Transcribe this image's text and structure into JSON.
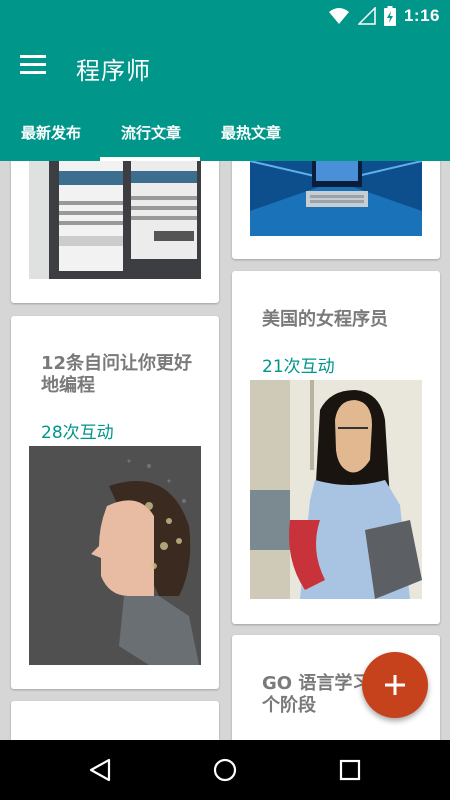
{
  "status_bar": {
    "time": "1:16",
    "icons": [
      "wifi-icon",
      "signal-icon",
      "battery-icon"
    ]
  },
  "app_bar": {
    "menu_icon": "hamburger-menu-icon",
    "title": "程序师"
  },
  "tabs": [
    {
      "label": "最新发布",
      "selected": false
    },
    {
      "label": "流行文章",
      "selected": true
    },
    {
      "label": "最热文章",
      "selected": false
    }
  ],
  "feed": {
    "cards": [
      {
        "title": "",
        "count": "",
        "image": "medicine-bottles-photo"
      },
      {
        "title": "",
        "count": "",
        "image": "computer-binary-photo"
      },
      {
        "title": "12条自问让你更好地编程",
        "count": "28次互动",
        "image": "woman-thinking-photo"
      },
      {
        "title": "美国的女程序员",
        "count": "21次互动",
        "image": "woman-with-cables-photo"
      },
      {
        "title": "GO 语言学习的 5 个阶段",
        "count": "",
        "image": ""
      },
      {
        "title": "",
        "count": "",
        "image": ""
      }
    ]
  },
  "fab": {
    "icon": "plus-icon"
  },
  "nav_bar": {
    "icons": [
      "back-icon",
      "home-icon",
      "recents-icon"
    ]
  },
  "colors": {
    "primary": "#00968a",
    "accent": "#c6421c",
    "count_text": "#00968a",
    "title_text": "#7a7a7a"
  }
}
